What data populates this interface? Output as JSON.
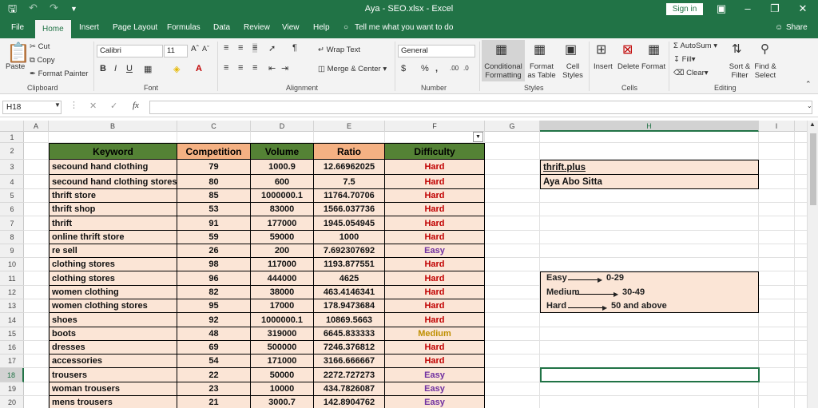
{
  "window": {
    "title": "Aya - SEO.xlsx - Excel",
    "signin": "Sign in"
  },
  "tabs": [
    "File",
    "Home",
    "Insert",
    "Page Layout",
    "Formulas",
    "Data",
    "Review",
    "View",
    "Help"
  ],
  "tell_me": "Tell me what you want to do",
  "share": "Share",
  "ribbon": {
    "clipboard": {
      "paste": "Paste",
      "cut": "Cut",
      "copy": "Copy",
      "format_painter": "Format Painter",
      "group": "Clipboard"
    },
    "font": {
      "name": "Calibri",
      "size": "11",
      "group": "Font"
    },
    "alignment": {
      "wrap": "Wrap Text",
      "merge": "Merge & Center",
      "group": "Alignment"
    },
    "number": {
      "format": "General",
      "group": "Number"
    },
    "styles": {
      "conditional": "Conditional Formatting",
      "format_table": "Format as Table",
      "cell_styles": "Cell Styles",
      "group": "Styles"
    },
    "cells": {
      "insert": "Insert",
      "delete": "Delete",
      "format": "Format",
      "group": "Cells"
    },
    "editing": {
      "autosum": "AutoSum",
      "fill": "Fill",
      "clear": "Clear",
      "sort": "Sort & Filter",
      "find": "Find & Select",
      "group": "Editing"
    }
  },
  "formula_bar": {
    "name_box": "H18",
    "formula": ""
  },
  "columns": [
    "A",
    "B",
    "C",
    "D",
    "E",
    "F",
    "G",
    "H",
    "I"
  ],
  "rows": [
    "1",
    "2",
    "3",
    "4",
    "5",
    "6",
    "7",
    "8",
    "9",
    "10",
    "11",
    "12",
    "13",
    "14",
    "15",
    "16",
    "17",
    "18",
    "19",
    "20"
  ],
  "table": {
    "headers": [
      "Keyword",
      "Competition",
      "Volume",
      "Ratio",
      "Difficulty"
    ],
    "rows": [
      [
        "secound hand clothing",
        "79",
        "1000.9",
        "12.66962025",
        "Hard"
      ],
      [
        "secound hand clothing stores",
        "80",
        "600",
        "7.5",
        "Hard"
      ],
      [
        "thrift store",
        "85",
        "1000000.1",
        "11764.70706",
        "Hard"
      ],
      [
        "thrift shop",
        "53",
        "83000",
        "1566.037736",
        "Hard"
      ],
      [
        "thrift",
        "91",
        "177000",
        "1945.054945",
        "Hard"
      ],
      [
        "online thrift store",
        "59",
        "59000",
        "1000",
        "Hard"
      ],
      [
        "re sell",
        "26",
        "200",
        "7.692307692",
        "Easy"
      ],
      [
        "clothing stores",
        "98",
        "117000",
        "1193.877551",
        "Hard"
      ],
      [
        "clothing stores",
        "96",
        "444000",
        "4625",
        "Hard"
      ],
      [
        "women clothing",
        "82",
        "38000",
        "463.4146341",
        "Hard"
      ],
      [
        "women clothing stores",
        "95",
        "17000",
        "178.9473684",
        "Hard"
      ],
      [
        "shoes",
        "92",
        "1000000.1",
        "10869.5663",
        "Hard"
      ],
      [
        "boots",
        "48",
        "319000",
        "6645.833333",
        "Medium"
      ],
      [
        "dresses",
        "69",
        "500000",
        "7246.376812",
        "Hard"
      ],
      [
        "accessories",
        "54",
        "171000",
        "3166.666667",
        "Hard"
      ],
      [
        "trousers",
        "22",
        "50000",
        "2272.727273",
        "Easy"
      ],
      [
        "woman trousers",
        "23",
        "10000",
        "434.7826087",
        "Easy"
      ],
      [
        "mens trousers",
        "21",
        "3000.7",
        "142.8904762",
        "Easy"
      ]
    ]
  },
  "side_info": {
    "site": "thrift.plus",
    "author": "Aya Abo Sitta"
  },
  "legend": [
    {
      "label": "Easy",
      "range": "0-29"
    },
    {
      "label": "Medium",
      "range": "30-49"
    },
    {
      "label": "Hard",
      "range": "50 and above"
    }
  ],
  "colors": {
    "excel_green": "#217346",
    "header_green": "#548235",
    "header_peach": "#f4b183",
    "row_fill": "#fbe5d6",
    "hard": "#c00000",
    "easy": "#7030a0",
    "medium": "#bf8f00"
  }
}
